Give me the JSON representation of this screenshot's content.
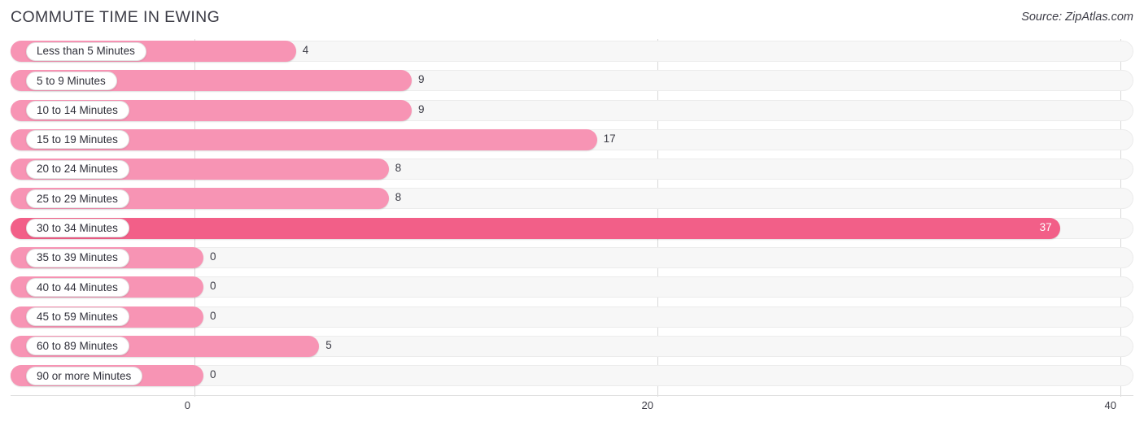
{
  "header": {
    "title": "COMMUTE TIME IN EWING",
    "source": "Source: ZipAtlas.com"
  },
  "axis": {
    "ticks": [
      "0",
      "20",
      "40"
    ],
    "tick_values": [
      0,
      20,
      40
    ]
  },
  "colors": {
    "bar_light": "#f794b4",
    "bar_dark": "#f25f88",
    "track": "#f7f7f7",
    "grid": "#d8d8d8",
    "text": "#3c3c46",
    "pill_bg": "#ffffff"
  },
  "chart_data": {
    "type": "bar",
    "orientation": "horizontal",
    "title": "COMMUTE TIME IN EWING",
    "subtitle": "",
    "source": "Source: ZipAtlas.com",
    "xlabel": "",
    "ylabel": "",
    "xlim": [
      0,
      40
    ],
    "xticks": [
      0,
      20,
      40
    ],
    "grid": true,
    "legend": "none",
    "categories": [
      "Less than 5 Minutes",
      "5 to 9 Minutes",
      "10 to 14 Minutes",
      "15 to 19 Minutes",
      "20 to 24 Minutes",
      "25 to 29 Minutes",
      "30 to 34 Minutes",
      "35 to 39 Minutes",
      "40 to 44 Minutes",
      "45 to 59 Minutes",
      "60 to 89 Minutes",
      "90 or more Minutes"
    ],
    "values": [
      4,
      9,
      9,
      17,
      8,
      8,
      37,
      0,
      0,
      0,
      5,
      0
    ],
    "value_labels": [
      "4",
      "9",
      "9",
      "17",
      "8",
      "8",
      "37",
      "0",
      "0",
      "0",
      "5",
      "0"
    ]
  },
  "rows": [
    {
      "label": "Less than 5 Minutes",
      "value": 4,
      "value_label": "4",
      "highlight": false,
      "inside": false
    },
    {
      "label": "5 to 9 Minutes",
      "value": 9,
      "value_label": "9",
      "highlight": false,
      "inside": false
    },
    {
      "label": "10 to 14 Minutes",
      "value": 9,
      "value_label": "9",
      "highlight": false,
      "inside": false
    },
    {
      "label": "15 to 19 Minutes",
      "value": 17,
      "value_label": "17",
      "highlight": false,
      "inside": false
    },
    {
      "label": "20 to 24 Minutes",
      "value": 8,
      "value_label": "8",
      "highlight": false,
      "inside": false
    },
    {
      "label": "25 to 29 Minutes",
      "value": 8,
      "value_label": "8",
      "highlight": false,
      "inside": false
    },
    {
      "label": "30 to 34 Minutes",
      "value": 37,
      "value_label": "37",
      "highlight": true,
      "inside": true
    },
    {
      "label": "35 to 39 Minutes",
      "value": 0,
      "value_label": "0",
      "highlight": false,
      "inside": false
    },
    {
      "label": "40 to 44 Minutes",
      "value": 0,
      "value_label": "0",
      "highlight": false,
      "inside": false
    },
    {
      "label": "45 to 59 Minutes",
      "value": 0,
      "value_label": "0",
      "highlight": false,
      "inside": false
    },
    {
      "label": "60 to 89 Minutes",
      "value": 5,
      "value_label": "5",
      "highlight": false,
      "inside": false
    },
    {
      "label": "90 or more Minutes",
      "value": 0,
      "value_label": "0",
      "highlight": false,
      "inside": false
    }
  ]
}
